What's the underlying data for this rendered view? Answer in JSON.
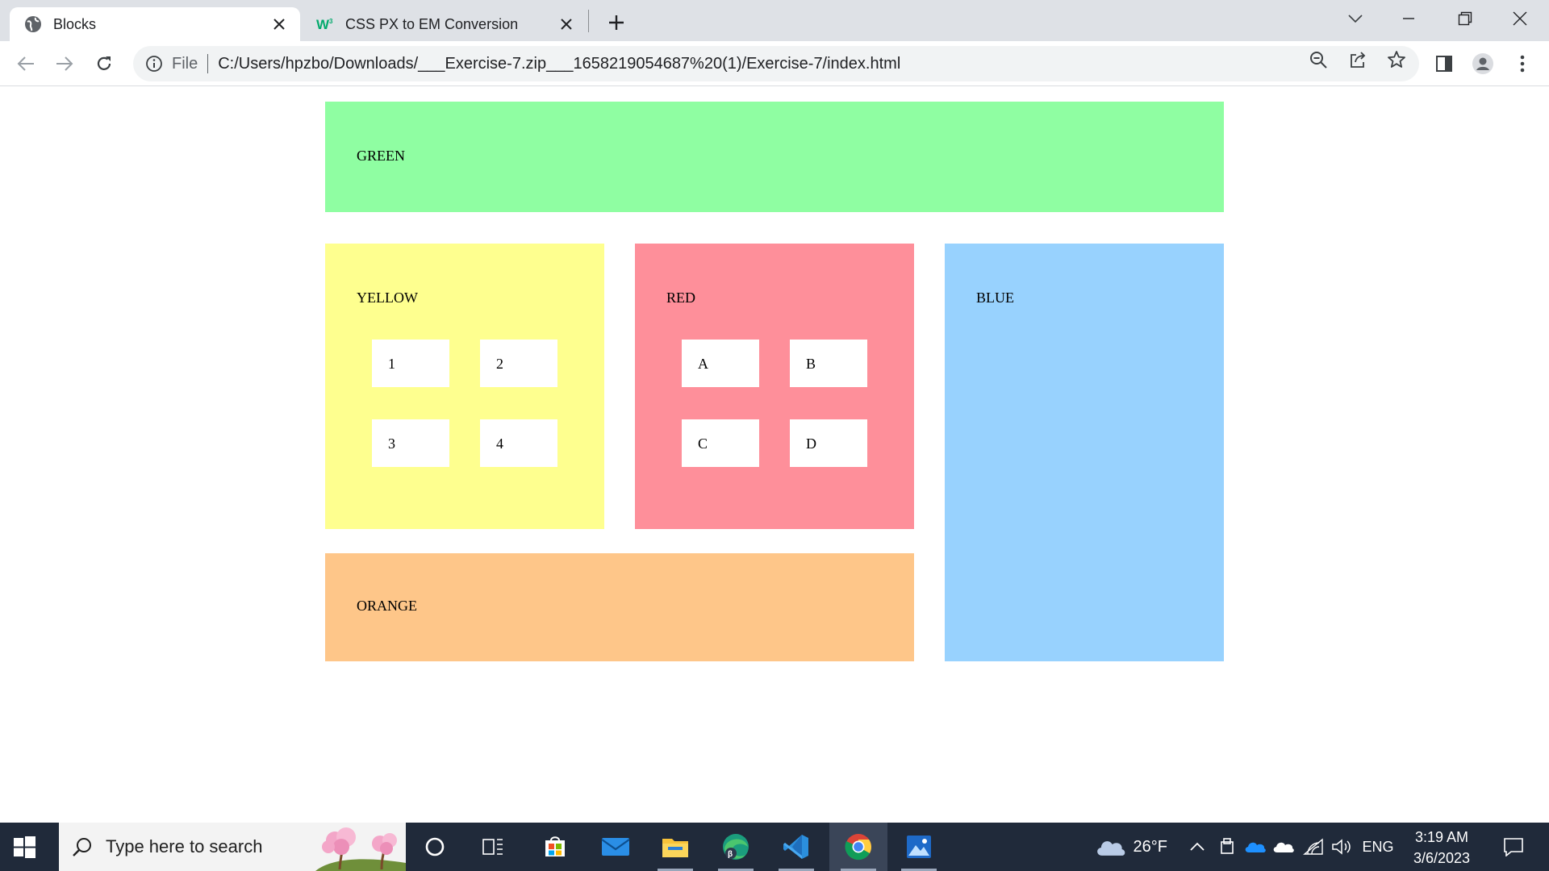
{
  "browser": {
    "tabs": [
      {
        "title": "Blocks",
        "icon": "globe-icon",
        "active": true
      },
      {
        "title": "CSS PX to EM Conversion",
        "icon": "w3-favicon-icon",
        "active": false
      }
    ],
    "address": {
      "scheme_label": "File",
      "url": "C:/Users/hpzbo/Downloads/___Exercise-7.zip___1658219054687%20(1)/Exercise-7/index.html"
    }
  },
  "page": {
    "green": {
      "label": "GREEN",
      "color": "#8ffea2"
    },
    "yellow": {
      "label": "YELLOW",
      "color": "#feff8f",
      "cells": [
        "1",
        "2",
        "3",
        "4"
      ]
    },
    "red": {
      "label": "RED",
      "color": "#fe8f9a",
      "cells": [
        "A",
        "B",
        "C",
        "D"
      ]
    },
    "blue": {
      "label": "BLUE",
      "color": "#98d2fe"
    },
    "orange": {
      "label": "ORANGE",
      "color": "#fec689"
    }
  },
  "taskbar": {
    "search_placeholder": "Type here to search",
    "weather": "26°F",
    "language": "ENG",
    "time": "3:19 AM",
    "date": "3/6/2023"
  }
}
